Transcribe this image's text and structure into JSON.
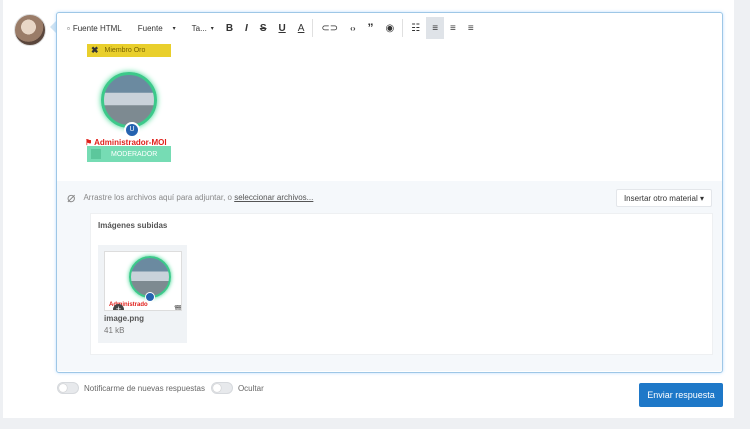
{
  "toolbar": {
    "html_source": "Fuente HTML",
    "font_family": "Fuente",
    "font_size": "Ta...",
    "bold": "B",
    "italic": "I",
    "strike": "S",
    "underline": "U",
    "text_color": "A",
    "quote": "”"
  },
  "content": {
    "member_badge": "Miembro Oro",
    "admin_label": "Administrador-MOI",
    "moderator_badge": "MODERADOR"
  },
  "attach": {
    "drop_text": "Arrastre los archivos aquí para adjuntar, o",
    "select_link": "seleccionar archivos...",
    "insert_button": "Insertar otro material ▾"
  },
  "uploads": {
    "title": "Imágenes subidas",
    "files": [
      {
        "name": "image.png",
        "size": "41 kB",
        "thumb_text": "Administrado"
      }
    ]
  },
  "footer": {
    "notify_label": "Notificarme de nuevas respuestas",
    "hide_label": "Ocultar",
    "submit_label": "Enviar respuesta"
  },
  "colors": {
    "accent": "#1e78c8",
    "member_gold": "#e9cf2c",
    "moderator_green": "#76dcb4",
    "admin_red": "#e0201b"
  }
}
